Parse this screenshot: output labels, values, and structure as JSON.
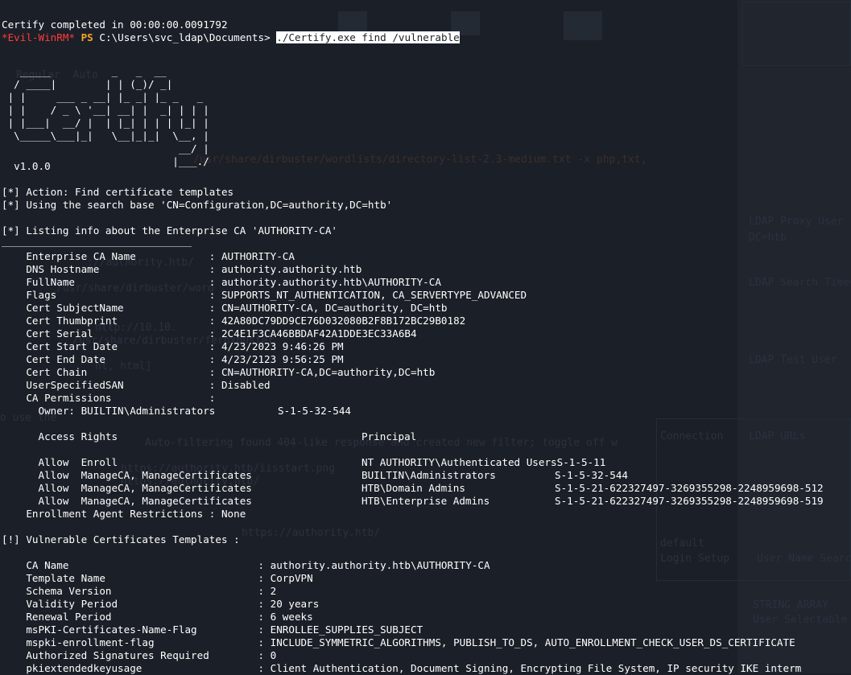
{
  "prompt": {
    "completed": "Certify completed in 00:00:00.0091792",
    "evil": "*Evil-WinRM*",
    "ps": "PS",
    "path": "C:\\Users\\svc_ldap\\Documents>",
    "command": "./Certify.exe find /vulnerable"
  },
  "banner": {
    "ascii": "   _____          _   _  __\n  / ____|        | | (_)/ _|\n | |     ___ _ __| |_ _| |_ _   _\n | |    / _ \\ '__| __| |  _| | | |\n | |___|  __/ |  | |_| | | | |_| |\n  \\_____\\___|_|   \\__|_|_|  \\__, |\n                             __/ |\n                            |___./",
    "version": "  v1.0.0"
  },
  "actions": {
    "action": "[*] Action: Find certificate templates",
    "search_base": "[*] Using the search base 'CN=Configuration,DC=authority,DC=htb'",
    "listing": "[*] Listing info about the Enterprise CA 'AUTHORITY-CA'"
  },
  "ca": {
    "fields": [
      {
        "k": "    Enterprise CA Name            ",
        "v": ": AUTHORITY-CA"
      },
      {
        "k": "    DNS Hostname                  ",
        "v": ": authority.authority.htb"
      },
      {
        "k": "    FullName                      ",
        "v": ": authority.authority.htb\\AUTHORITY-CA"
      },
      {
        "k": "    Flags                         ",
        "v": ": SUPPORTS_NT_AUTHENTICATION, CA_SERVERTYPE_ADVANCED"
      },
      {
        "k": "    Cert SubjectName              ",
        "v": ": CN=AUTHORITY-CA, DC=authority, DC=htb"
      },
      {
        "k": "    Cert Thumbprint               ",
        "v": ": 42A80DC79DD9CE76D032080B2F8B172BC29B0182"
      },
      {
        "k": "    Cert Serial                   ",
        "v": ": 2C4E1F3CA46BBDAF42A1DDE3EC33A6B4"
      },
      {
        "k": "    Cert Start Date               ",
        "v": ": 4/23/2023 9:46:26 PM"
      },
      {
        "k": "    Cert End Date                 ",
        "v": ": 4/23/2123 9:56:25 PM"
      },
      {
        "k": "    Cert Chain                    ",
        "v": ": CN=AUTHORITY-CA,DC=authority,DC=htb"
      },
      {
        "k": "    UserSpecifiedSAN              ",
        "v": ": Disabled"
      },
      {
        "k": "    CA Permissions                ",
        "v": ":"
      }
    ],
    "owner": {
      "label": "      Owner: BUILTIN\\Administrators",
      "sid": "S-1-5-32-544"
    },
    "rights_header": {
      "rights": "      Access Rights",
      "principal": "Principal"
    },
    "rights": [
      {
        "right": "      Allow  Enroll",
        "principal": "NT AUTHORITY\\Authenticated UsersS-1-5-11",
        "sid": ""
      },
      {
        "right": "      Allow  ManageCA, ManageCertificates",
        "principal": "BUILTIN\\Administrators",
        "sid": "S-1-5-32-544"
      },
      {
        "right": "      Allow  ManageCA, ManageCertificates",
        "principal": "HTB\\Domain Admins",
        "sid": "S-1-5-21-622327497-3269355298-2248959698-512"
      },
      {
        "right": "      Allow  ManageCA, ManageCertificates",
        "principal": "HTB\\Enterprise Admins",
        "sid": "S-1-5-21-622327497-3269355298-2248959698-519"
      }
    ],
    "enrollment_restrictions": "    Enrollment Agent Restrictions : None"
  },
  "vulnerable": {
    "header": "[!] Vulnerable Certificates Templates :",
    "fields": [
      {
        "k": "    CA Name                               ",
        "v": ": authority.authority.htb\\AUTHORITY-CA"
      },
      {
        "k": "    Template Name                         ",
        "v": ": CorpVPN"
      },
      {
        "k": "    Schema Version                        ",
        "v": ": 2"
      },
      {
        "k": "    Validity Period                       ",
        "v": ": 20 years"
      },
      {
        "k": "    Renewal Period                        ",
        "v": ": 6 weeks"
      },
      {
        "k": "    msPKI-Certificates-Name-Flag          ",
        "v": ": ENROLLEE_SUPPLIES_SUBJECT"
      },
      {
        "k": "    mspki-enrollment-flag                 ",
        "v": ": INCLUDE_SYMMETRIC_ALGORITHMS, PUBLISH_TO_DS, AUTO_ENROLLMENT_CHECK_USER_DS_CERTIFICATE"
      },
      {
        "k": "    Authorized Signatures Required        ",
        "v": ": 0"
      },
      {
        "k": "    pkiextendedkeyusage                   ",
        "v": ": Client Authentication, Document Signing, Encrypting File System, IP security IKE interm"
      }
    ]
  },
  "background": {
    "texts": [
      "Regular  Auto",
      "/usr/share/dirbuster/wordlists/directory-list-2.3-medium.txt -x php,txt,",
      "://authority.htb/",
      "/usr/share/dirbuster/word",
      "http://10.10.",
      "/usr/share/dirbuster/feroxbuster",
      "ht, html]",
      "o use the",
      "Auto-filtering found 404-like response and created new filter; toggle off w",
      "https://authority.htb/iisstart.png",
      "https://authority.htb/",
      "https://authority.htb/",
      "Connection",
      "LDAP URLs",
      "LDAP Proxy User",
      "DC=htb",
      "LDAP Search Timeout",
      "LDAP Test User",
      "default",
      "Login Setup",
      "User Name Search",
      "STRING_ARRAY",
      "User Selectable"
    ]
  }
}
